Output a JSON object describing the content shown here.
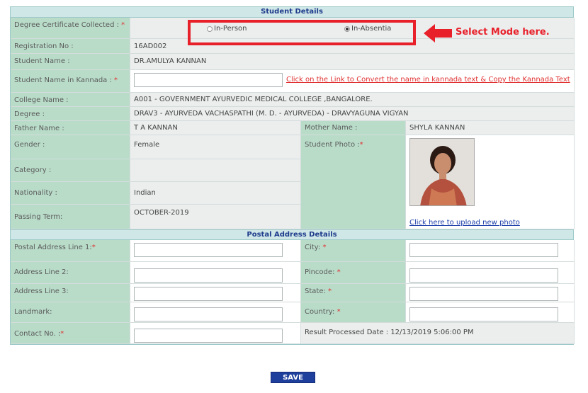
{
  "student_details": {
    "heading": "Student Details",
    "degree_collected": {
      "label": "Degree Certificate Collected :",
      "options": [
        "In-Person",
        "In-Absentia"
      ],
      "selected": "In-Absentia"
    },
    "registration_no": {
      "label": "Registration No :",
      "value": "16AD002"
    },
    "student_name": {
      "label": "Student Name :",
      "value": "DR.AMULYA KANNAN"
    },
    "name_kannada": {
      "label": "Student Name in Kannada :",
      "value": "",
      "link": "Click on the Link to Convert the name in kannada text & Copy the Kannada Text"
    },
    "college_name": {
      "label": "College Name :",
      "value": "A001 - GOVERNMENT AYURVEDIC MEDICAL COLLEGE ,BANGALORE."
    },
    "degree": {
      "label": "Degree :",
      "value": "DRAV3 - AYURVEDA VACHASPATHI (M. D. - AYURVEDA) - DRAVYAGUNA VIGYAN"
    },
    "father_name": {
      "label": "Father Name :",
      "value": "T A KANNAN"
    },
    "mother_name": {
      "label": "Mother Name :",
      "value": "SHYLA KANNAN"
    },
    "gender": {
      "label": "Gender :",
      "value": "Female"
    },
    "student_photo": {
      "label": "Student Photo :",
      "link": "Click here to upload new photo"
    },
    "category": {
      "label": "Category :",
      "value": ""
    },
    "nationality": {
      "label": "Nationality :",
      "value": "Indian"
    },
    "passing_term": {
      "label": "Passing Term:",
      "value": "OCTOBER-2019"
    }
  },
  "postal": {
    "heading": "Postal Address Details",
    "line1_label": "Postal Address Line 1:",
    "line2_label": "Address Line 2:",
    "line3_label": "Address Line 3:",
    "landmark_label": "Landmark:",
    "contact_label": "Contact No. :",
    "city_label": "City:",
    "pincode_label": "Pincode:",
    "state_label": "State:",
    "country_label": "Country:",
    "result_processed": "Result Processed Date : 12/13/2019 5:06:00 PM"
  },
  "annotation": {
    "text": "Select Mode here.",
    "color": "#e8202a"
  },
  "save_label": "SAVE",
  "required_marker": "*",
  "colors": {
    "label_bg": "#b9dcc9",
    "value_bg": "#eceeee",
    "header_bg": "#cfe7e7",
    "header_text": "#1e3c8c",
    "save_bg": "#1f3f9c"
  }
}
